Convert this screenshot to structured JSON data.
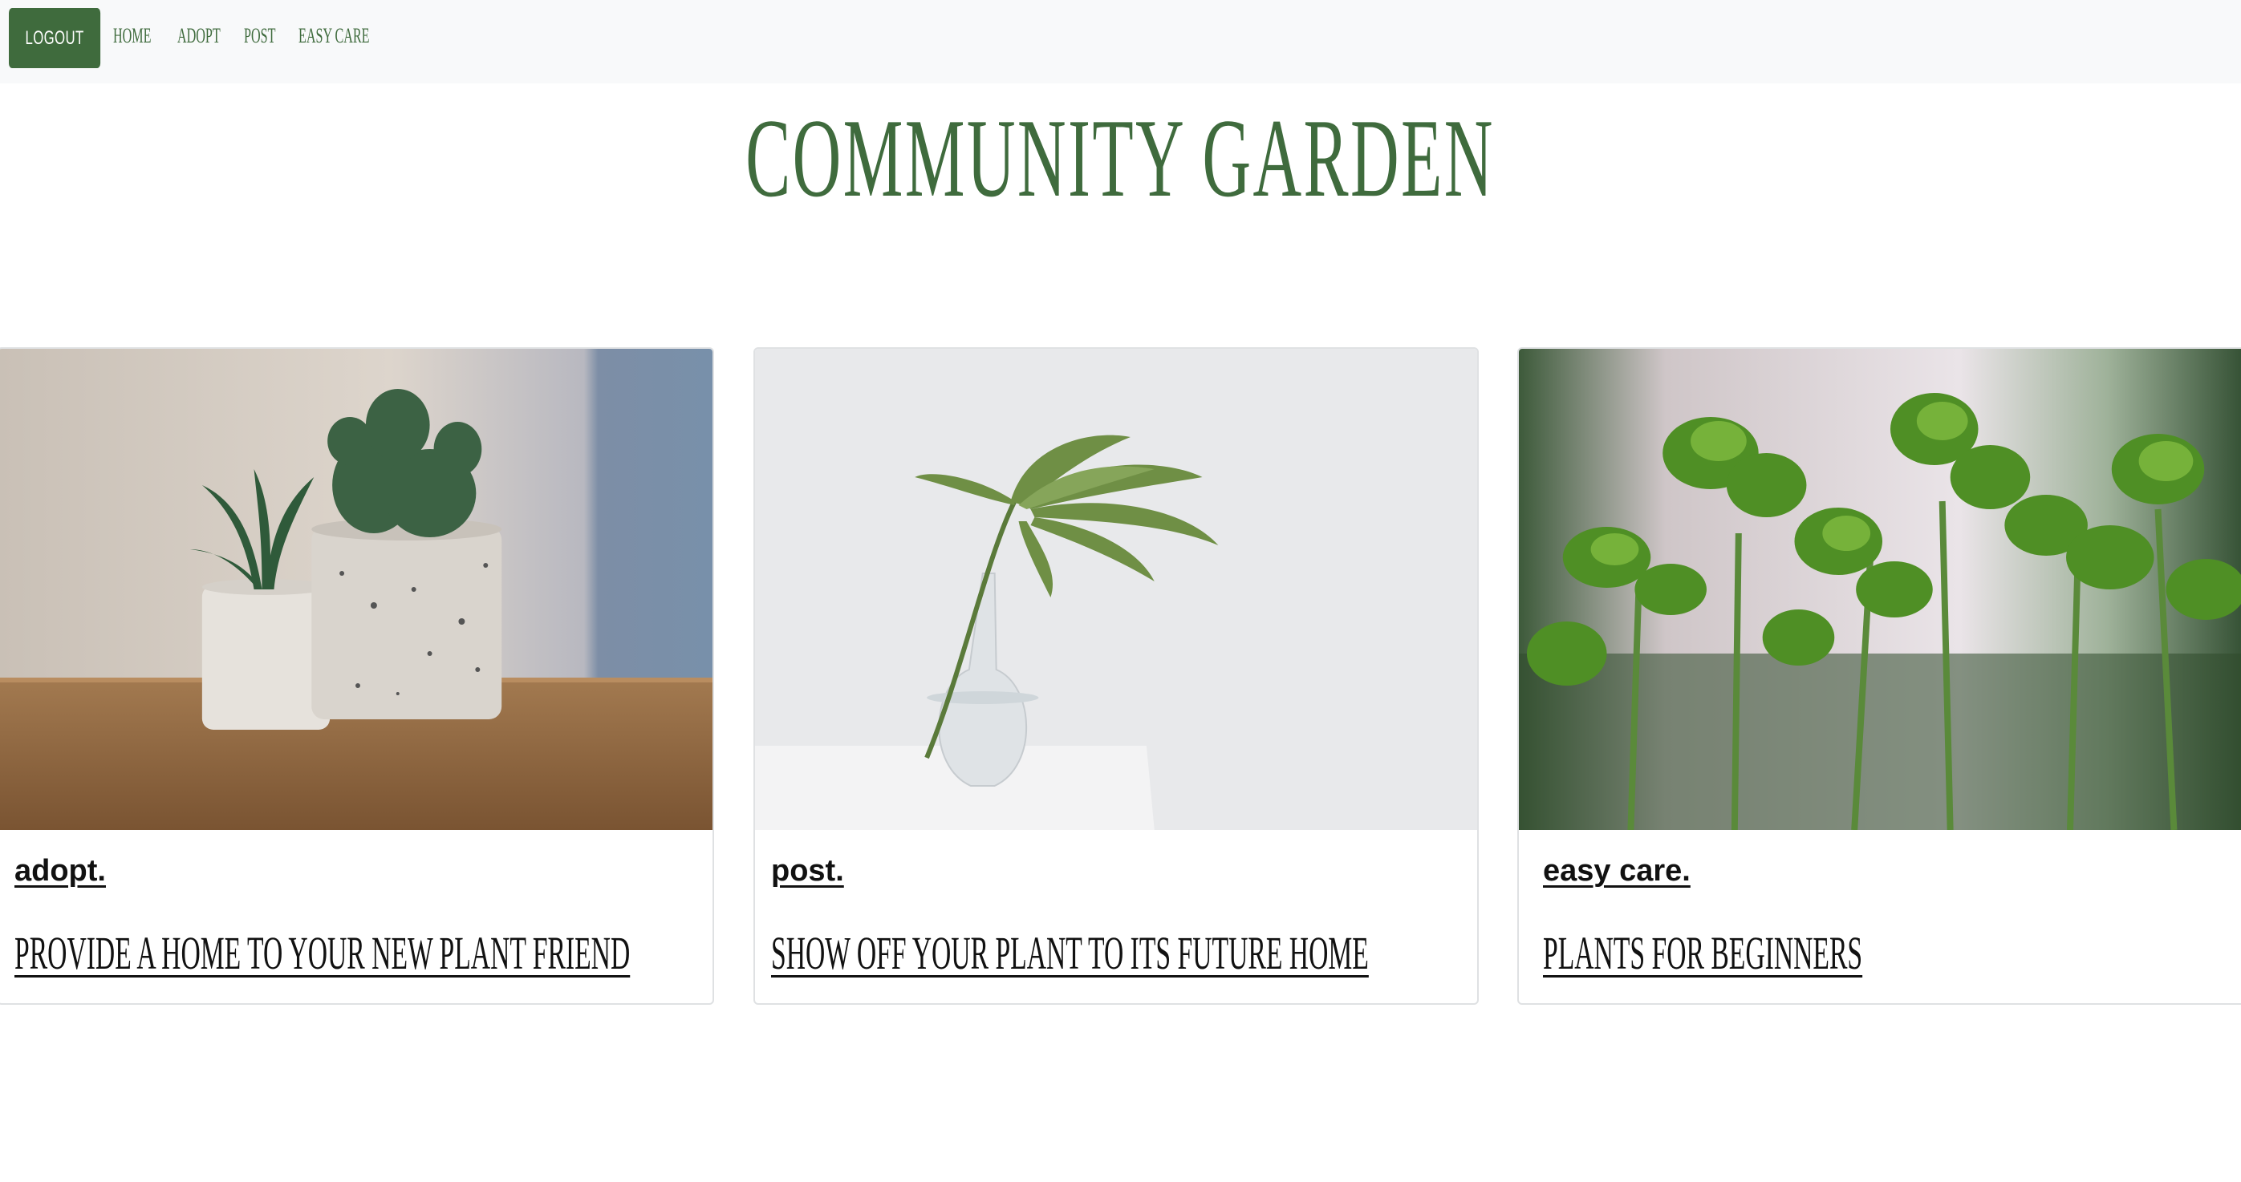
{
  "nav": {
    "logout_label": "LOGOUT",
    "home_label": "HOME",
    "adopt_label": "ADOPT",
    "post_label": "POST",
    "easy_care_label": "EASY CARE"
  },
  "page_title": "COMMUNITY GARDEN",
  "cards": [
    {
      "heading": "adopt.",
      "subtitle": "PROVIDE A HOME TO YOUR NEW PLANT FRIEND",
      "image": "potted-cacti-photo"
    },
    {
      "heading": "post.",
      "subtitle": "SHOW OFF YOUR PLANT TO ITS FUTURE HOME",
      "image": "monstera-vase-photo"
    },
    {
      "heading": "easy care.",
      "subtitle": "PLANTS FOR BEGINNERS",
      "image": "seedlings-photo"
    }
  ],
  "colors": {
    "accent": "#3f6b3d",
    "navbar_bg": "#f8f9fa"
  }
}
